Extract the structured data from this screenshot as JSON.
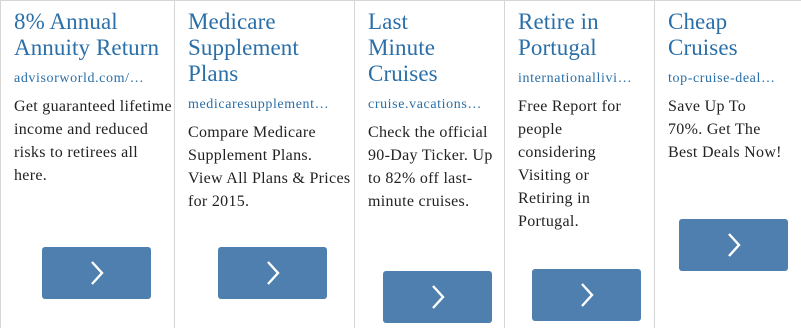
{
  "ads": [
    {
      "title": "8% Annual Annuity Return",
      "url": "advisorworld.com/…",
      "description": "Get guaranteed lifetime income and reduced risks to retirees all here.",
      "button_icon": "chevron-right-icon"
    },
    {
      "title": "Medicare Supplement Plans",
      "url": "medicaresupplement…",
      "description": "Compare Medicare Supplement Plans. View All Plans & Prices for 2015.",
      "button_icon": "chevron-right-icon"
    },
    {
      "title": "Last Minute Cruises",
      "url": "cruise.vacations…",
      "description": "Check the official 90-Day Ticker. Up to 82% off last-minute cruises.",
      "button_icon": "chevron-right-icon"
    },
    {
      "title": "Retire in Portugal",
      "url": "internationallivi…",
      "description": "Free Report for people considering Visiting or Retiring in Portugal.",
      "button_icon": "chevron-right-icon"
    },
    {
      "title": "Cheap Cruises",
      "url": "top-cruise-deal…",
      "description": "Save Up To 70%. Get The Best Deals Now!",
      "button_icon": "chevron-right-icon"
    }
  ],
  "colors": {
    "link": "#2a6fa8",
    "button": "#4f7fae",
    "divider": "#d6d6d6",
    "text": "#222222"
  }
}
